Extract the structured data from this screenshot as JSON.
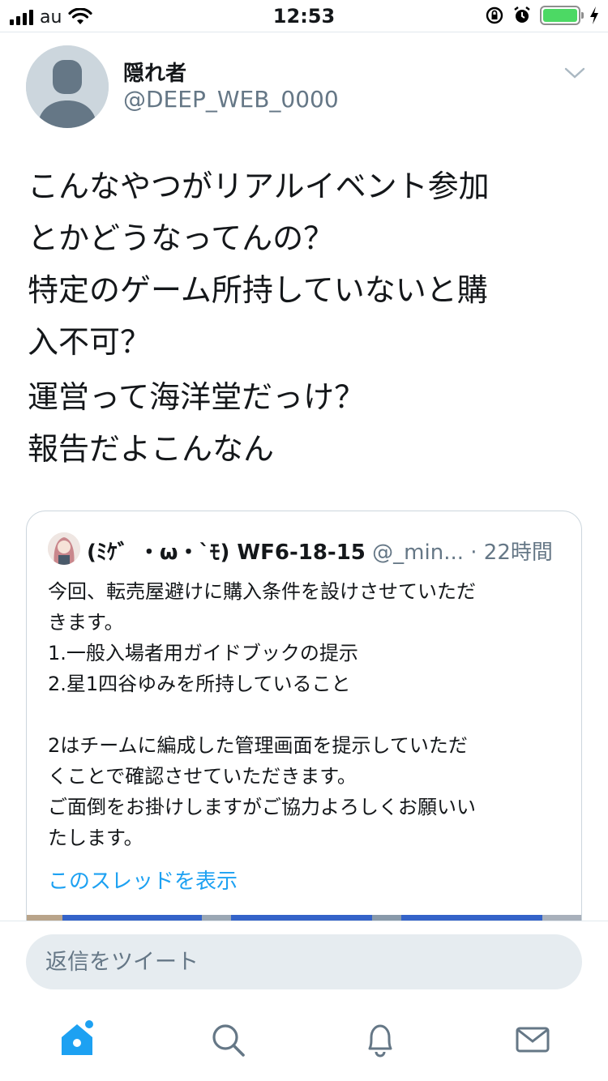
{
  "status_bar": {
    "carrier": "au",
    "time": "12:53"
  },
  "tweet": {
    "author_name": "隠れ者",
    "author_handle": "@DEEP_WEB_0000",
    "paragraphs": [
      "こんなやつがリアルイベント参加\nとかどうなってんの？\n特定のゲーム所持していないと購\n入不可？",
      "運営って海洋堂だっけ？\n報告だよこんなん"
    ]
  },
  "quoted_tweet": {
    "author_name": "(ﾐｹ゛・ω・`ﾓ) WF6-18-15",
    "author_handle": "@_min...",
    "separator": "·",
    "time": "22時間",
    "lines": [
      "今回、転売屋避けに購入条件を設けさせていただ\nきます。\n1.一般入場者用ガイドブックの提示\n2.星1四谷ゆみを所持していること",
      "",
      "2はチームに編成した管理画面を提示していただ\nくことで確認させていただきます。\nご面倒をお掛けしますがご協力よろしくお願いい\nたします。"
    ],
    "show_thread": "このスレッドを表示"
  },
  "reply": {
    "placeholder": "返信をツイート"
  },
  "tab_bar": {
    "items": [
      "home-icon",
      "search-icon",
      "notifications-icon",
      "messages-icon"
    ],
    "active": "home-icon"
  },
  "colors": {
    "accent": "#1da1f2",
    "muted": "#657786",
    "text": "#14171a",
    "battery": "#4cd964"
  }
}
